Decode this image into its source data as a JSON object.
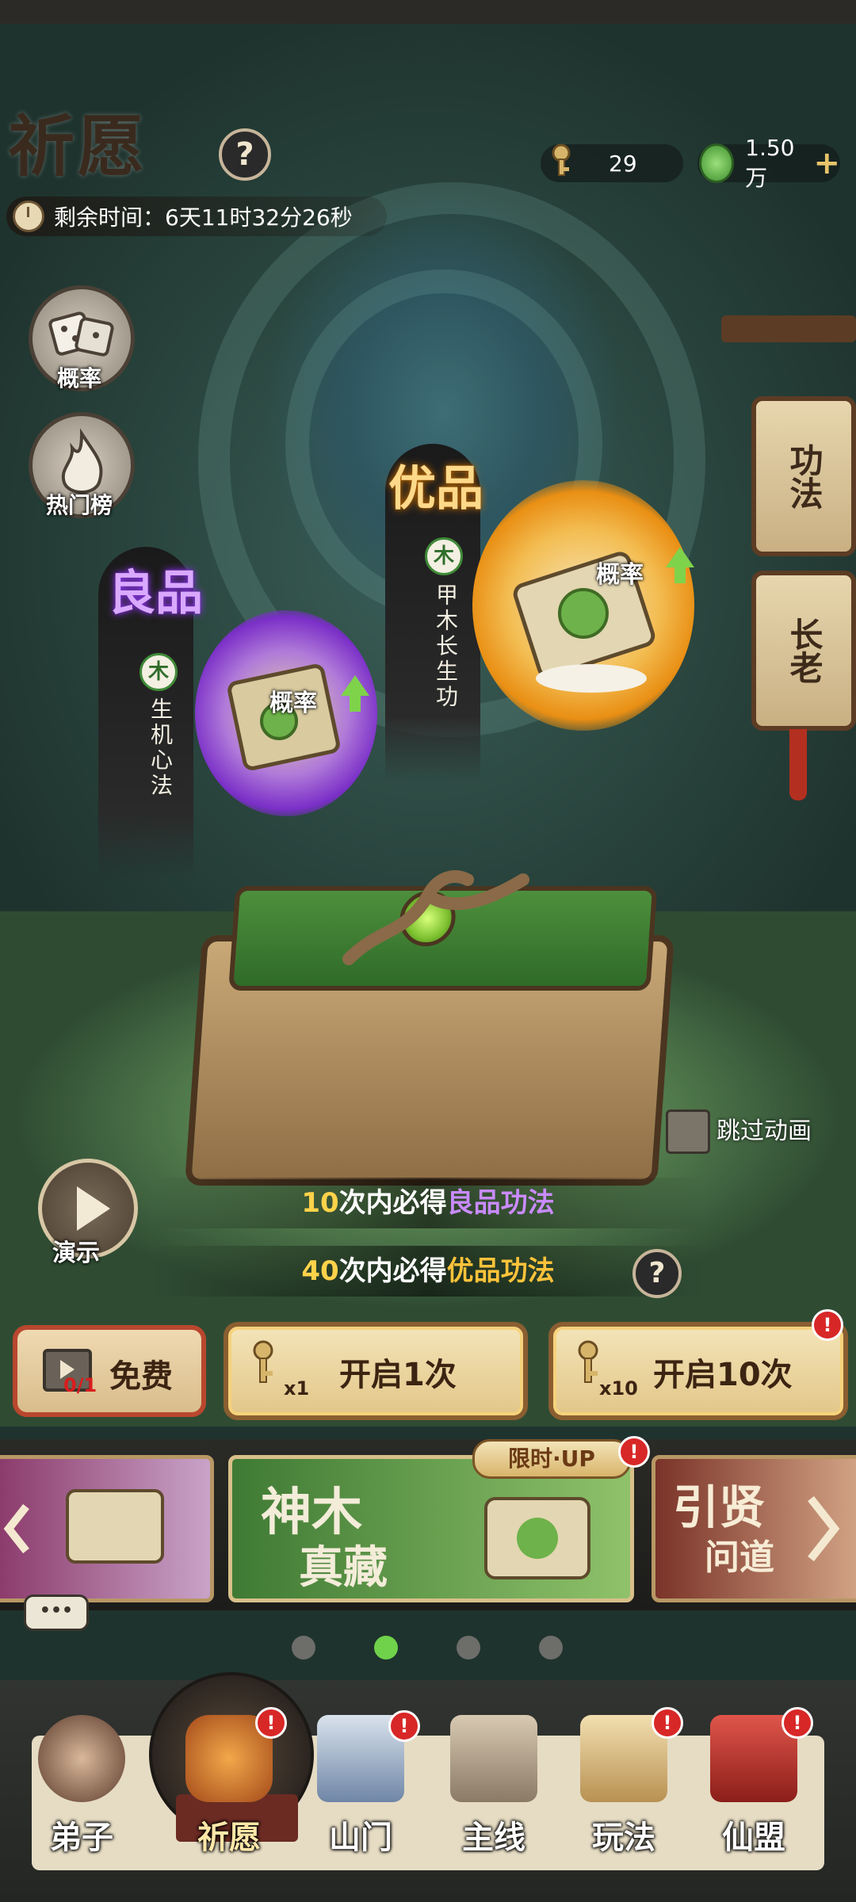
{
  "header": {
    "title": "祈愿",
    "help_icon": "question-icon",
    "help_glyph": "?",
    "timer": "剩余时间：6天11时32分26秒"
  },
  "currencies": [
    {
      "icon": "key-icon",
      "value": "29"
    },
    {
      "icon": "jade-icon",
      "value": "1.50万",
      "plus": "+"
    }
  ],
  "side_buttons": [
    {
      "label": "概率",
      "icon": "dice-icon"
    },
    {
      "label": "热门榜",
      "icon": "fire-icon"
    }
  ],
  "tabs": [
    {
      "label": "功法"
    },
    {
      "label": "长老"
    }
  ],
  "featured": {
    "good": {
      "grade": "良品",
      "element": "木",
      "name": "生机心法",
      "orb_label": "概率"
    },
    "great": {
      "grade": "优品",
      "element": "木",
      "name": "甲木长生功",
      "orb_label": "概率"
    }
  },
  "skip_animation": {
    "label": "跳过动画",
    "checked": false
  },
  "pity": [
    {
      "count": "10",
      "mid": "次内必得",
      "reward": "良品功法",
      "tier": "good"
    },
    {
      "count": "40",
      "mid": "次内必得",
      "reward": "优品功法",
      "tier": "great"
    }
  ],
  "pity_help_glyph": "?",
  "demo_label": "演示",
  "actions": {
    "free": {
      "label": "免费",
      "count": "0/1"
    },
    "once": {
      "label": "开启1次",
      "cost": "x1"
    },
    "ten": {
      "label": "开启10次",
      "cost": "x10",
      "badge": "!"
    }
  },
  "carousel": {
    "cards": [
      {
        "title": "",
        "note": "partially visible"
      },
      {
        "title_line1": "神木",
        "title_line2": "真藏",
        "tag": "限时·UP",
        "badge": "!"
      },
      {
        "title_line1": "引贤",
        "title_line2": "问道"
      }
    ],
    "active_index": 1,
    "page_count": 4,
    "more_glyph": "•••"
  },
  "bottom_nav": [
    {
      "label": "弟子",
      "badge": ""
    },
    {
      "label": "祈愿",
      "badge": "!",
      "active": true
    },
    {
      "label": "山门",
      "badge": "!"
    },
    {
      "label": "主线",
      "badge": ""
    },
    {
      "label": "玩法",
      "badge": "!"
    },
    {
      "label": "仙盟",
      "badge": "!"
    }
  ],
  "colors": {
    "good_grade": "#a64dff",
    "great_grade": "#ffb52b",
    "accent_green": "#7fd34b",
    "alert_red": "#d82727"
  }
}
